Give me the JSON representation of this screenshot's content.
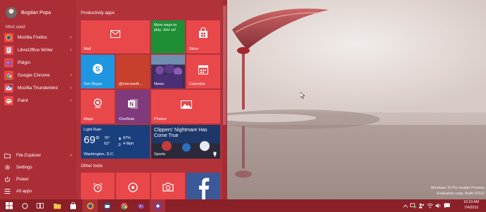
{
  "start_menu": {
    "user_name": "Bogdan Popa",
    "most_used_label": "Most used",
    "most_used": [
      {
        "label": "Mozilla Firefox",
        "has_submenu": true
      },
      {
        "label": "LibreOffice Writer",
        "has_submenu": true
      },
      {
        "label": "Pidgin",
        "has_submenu": false
      },
      {
        "label": "Google Chrome",
        "has_submenu": true
      },
      {
        "label": "Mozilla Thunderbird",
        "has_submenu": true
      },
      {
        "label": "Paint",
        "has_submenu": true
      }
    ],
    "chevron": "›",
    "bottom": {
      "file_explorer": "File Explorer",
      "settings": "Settings",
      "power": "Power",
      "all_apps": "All apps"
    }
  },
  "tiles": {
    "productivity_label": "Productivity apps",
    "other_tools_label": "Other tools",
    "mail": "Mail",
    "store_promo": "More ways to play. Join us!",
    "store": "Store",
    "get_skype": "Get Skype",
    "microsoft_twitter": "@microsoft...",
    "news": "News",
    "calendar": "Calendar",
    "maps": "Maps",
    "onenote": "OneNote",
    "photos": "Photos",
    "weather": {
      "condition": "Light Rain",
      "temp": "69°",
      "high": "76°",
      "low": "62°",
      "humidity": "87%",
      "wind": "4 Mph",
      "location": "Washington, D.C."
    },
    "sports_headline": "Clippers' Nightmare Has Come True",
    "sports": "Sports"
  },
  "taskbar": {
    "clock_time": "10:19 AM",
    "clock_date": "7/4/2015"
  },
  "watermark": {
    "line1": "Windows 10 Pro Insider Preview",
    "line2": "Evaluation copy. Build 10162"
  },
  "colors": {
    "accent": "#b2323a",
    "tile_red": "#e9484b",
    "skype_blue": "#1e96e0",
    "promo_green": "#1f8f35",
    "twitter_orange": "#c7402d",
    "onenote_purple": "#80397b",
    "weather_navy": "#1a3f7d",
    "taskbar": "#8a2028"
  }
}
